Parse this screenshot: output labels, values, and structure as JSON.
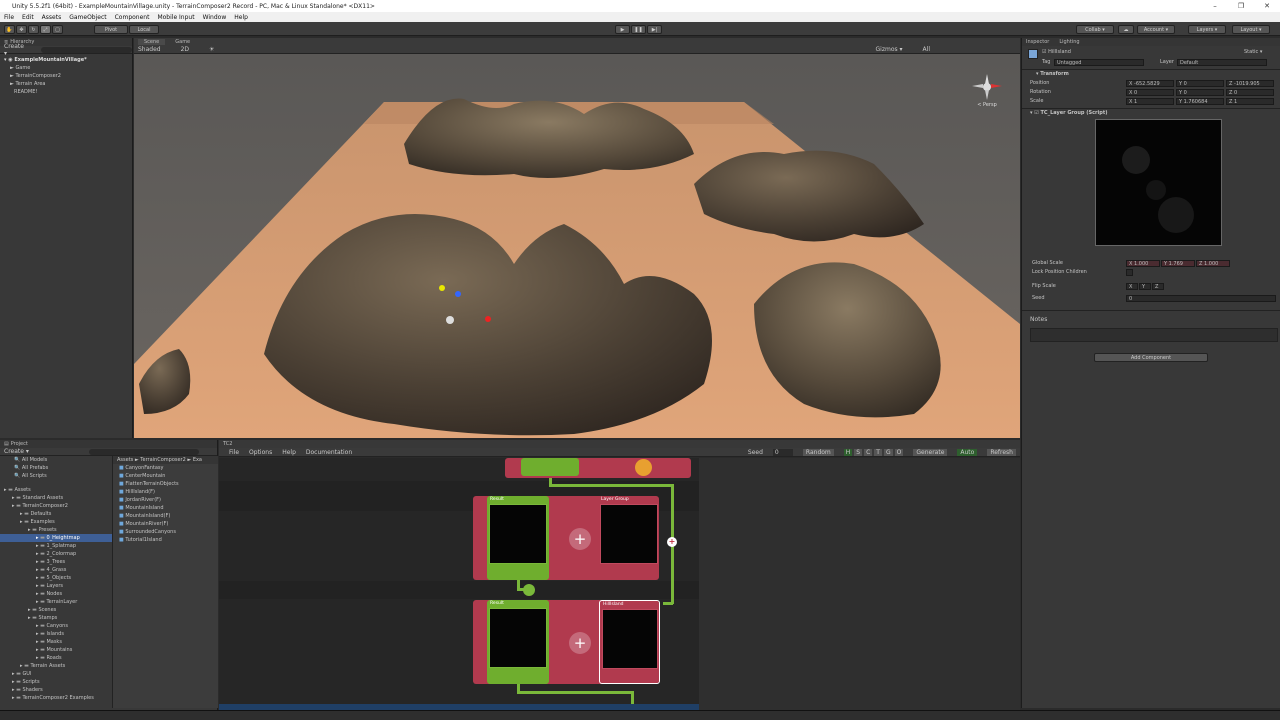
{
  "window": {
    "title": "Unity 5.5.2f1 (64bit) - ExampleMountainVillage.unity - TerrainComposer2 Record - PC, Mac & Linux Standalone* <DX11>",
    "controls": [
      "–",
      "❐",
      "✕"
    ]
  },
  "menu": [
    "File",
    "Edit",
    "Assets",
    "GameObject",
    "Component",
    "Mobile Input",
    "Window",
    "Help"
  ],
  "toolbar": {
    "pivot": "Pivot",
    "local": "Local",
    "play_icon": "▶",
    "pause_icon": "❚❚",
    "step_icon": "▶|",
    "collab": "Collab ▾",
    "account": "Account ▾",
    "layers": "Layers ▾",
    "layout": "Layout ▾"
  },
  "hierarchy": {
    "tab": "Hierarchy",
    "create": "Create ▾",
    "search_icon": "search-icon",
    "root": "ExampleMountainVillage*",
    "items": [
      "Game",
      "TerrainComposer2",
      "Terrain Area",
      "README!"
    ]
  },
  "scene": {
    "tabs": [
      "Scene",
      "Game"
    ],
    "shading": "Shaded",
    "mode2d": "2D",
    "gizmos": "Gizmos ▾",
    "search": "All",
    "persp": "< Persp"
  },
  "inspector": {
    "tabs": [
      "Inspector",
      "Lighting"
    ],
    "object_name": "HillIsland",
    "static": "Static ▾",
    "tag_label": "Tag",
    "tag_value": "Untagged",
    "layer_label": "Layer",
    "layer_value": "Default",
    "transform_title": "Transform",
    "position_label": "Position",
    "position": {
      "x": "X -652.5829",
      "y": "Y 0",
      "z": "Z -1019.905"
    },
    "rotation_label": "Rotation",
    "rotation": {
      "x": "X 0",
      "y": "Y 0",
      "z": "Z 0"
    },
    "scale_label": "Scale",
    "scale": {
      "x": "X 1",
      "y": "Y 1.760684",
      "z": "Z 1"
    },
    "script_title": "TC_Layer Group (Script)",
    "global_scale_label": "Global Scale",
    "global_scale": {
      "x": "X 1.000",
      "y": "Y 1.769",
      "z": "Z 1.000"
    },
    "lock_label": "Lock Position Children",
    "flip_label": "Flip Scale",
    "flip": {
      "x": "X",
      "y": "Y",
      "z": "Z"
    },
    "seed_label": "Seed",
    "seed_value": "0",
    "notes_label": "Notes",
    "add_component": "Add Component"
  },
  "project": {
    "tab": "Project",
    "create": "Create ▾",
    "favorites": [
      "All Models",
      "All Prefabs",
      "All Scripts"
    ],
    "tree": [
      {
        "label": "Assets",
        "indent": 0
      },
      {
        "label": "Standard Assets",
        "indent": 1
      },
      {
        "label": "TerrainComposer2",
        "indent": 1
      },
      {
        "label": "Defaults",
        "indent": 2
      },
      {
        "label": "Examples",
        "indent": 2
      },
      {
        "label": "Presets",
        "indent": 3
      },
      {
        "label": "0_Heightmap",
        "indent": 4,
        "selected": true
      },
      {
        "label": "1_Splatmap",
        "indent": 4
      },
      {
        "label": "2_Colormap",
        "indent": 4
      },
      {
        "label": "3_Trees",
        "indent": 4
      },
      {
        "label": "4_Grass",
        "indent": 4
      },
      {
        "label": "5_Objects",
        "indent": 4
      },
      {
        "label": "Layers",
        "indent": 4
      },
      {
        "label": "Nodes",
        "indent": 4
      },
      {
        "label": "TerrainLayer",
        "indent": 4
      },
      {
        "label": "Scenes",
        "indent": 3
      },
      {
        "label": "Stamps",
        "indent": 3
      },
      {
        "label": "Canyons",
        "indent": 4
      },
      {
        "label": "Islands",
        "indent": 4
      },
      {
        "label": "Masks",
        "indent": 4
      },
      {
        "label": "Mountains",
        "indent": 4
      },
      {
        "label": "Roads",
        "indent": 4
      },
      {
        "label": "Terrain Assets",
        "indent": 2
      },
      {
        "label": "GUI",
        "indent": 1
      },
      {
        "label": "Scripts",
        "indent": 1
      },
      {
        "label": "Shaders",
        "indent": 1
      },
      {
        "label": "TerrainComposer2 Examples",
        "indent": 1
      }
    ],
    "breadcrumb": "Assets ► TerrainComposer2 ► Exa",
    "files": [
      "CanyonFantasy",
      "CenterMountain",
      "FlattenTerrainObjects",
      "HillIsland(F)",
      "JordanRiver(F)",
      "MountainIsland",
      "MountainIsland(F)",
      "MountainRiver(F)",
      "SurroundedCanyons",
      "Tutorial1Island"
    ]
  },
  "tc2": {
    "tab": "TC2",
    "menu": [
      "File",
      "Options",
      "Help",
      "Documentation"
    ],
    "seed_label": "Seed",
    "seed_value": "0",
    "random": "Random",
    "toggles": [
      "H",
      "S",
      "C",
      "T",
      "G",
      "O"
    ],
    "generate": "Generate",
    "auto": "Auto",
    "refresh": "Refresh",
    "node_result_1": "Result",
    "node_layergroup": "Layer Group",
    "node_result_2": "Result",
    "node_hillisland": "HillIsland",
    "plus": "+"
  }
}
